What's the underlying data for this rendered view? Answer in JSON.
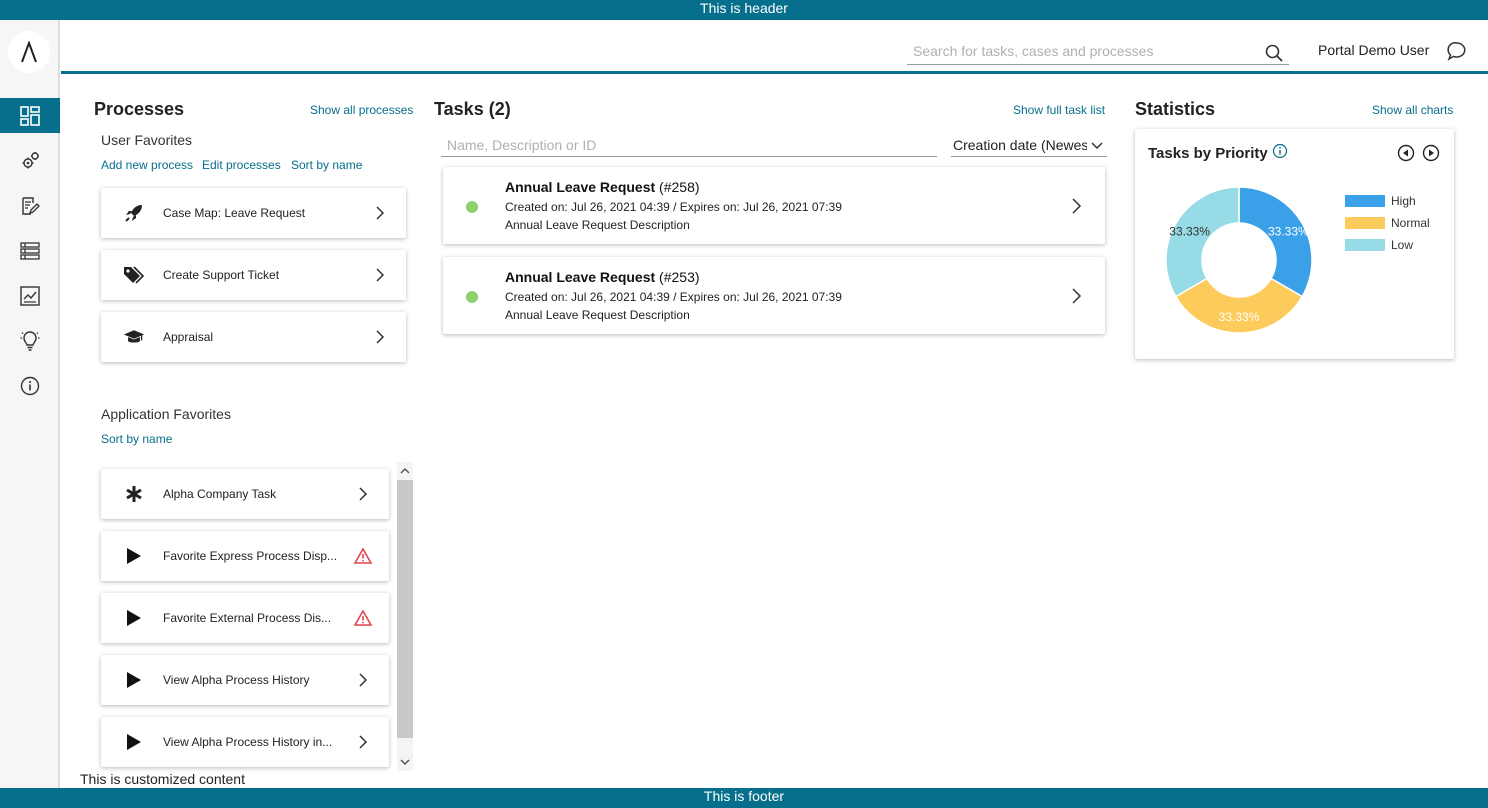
{
  "header_banner": "This is header",
  "footer_banner": "This is footer",
  "custom_content": "This is customized content",
  "topbar": {
    "search_placeholder": "Search for tasks, cases and processes",
    "user_name": "Portal Demo User"
  },
  "processes": {
    "title": "Processes",
    "show_all": "Show all processes",
    "user_favorites_title": "User Favorites",
    "add_new": "Add new process",
    "edit": "Edit processes",
    "sort": "Sort by name",
    "user_items": [
      {
        "label": "Case Map: Leave Request",
        "icon": "rocket-icon"
      },
      {
        "label": "Create Support Ticket",
        "icon": "tag-icon"
      },
      {
        "label": "Appraisal",
        "icon": "graduation-cap-icon"
      }
    ],
    "app_favorites_title": "Application Favorites",
    "app_sort": "Sort by name",
    "app_items": [
      {
        "label": "Alpha Company Task",
        "icon": "asterisk-icon",
        "status": "chevron"
      },
      {
        "label": "Favorite Express Process Disp...",
        "icon": "play-icon",
        "status": "warning"
      },
      {
        "label": "Favorite External Process Dis...",
        "icon": "play-icon",
        "status": "warning"
      },
      {
        "label": "View Alpha Process History",
        "icon": "play-icon",
        "status": "chevron"
      },
      {
        "label": "View Alpha Process History in...",
        "icon": "play-icon",
        "status": "chevron"
      }
    ]
  },
  "tasks": {
    "title": "Tasks (2)",
    "show_full": "Show full task list",
    "filter_placeholder": "Name, Description or ID",
    "sort_value": "Creation date (Newest first)",
    "items": [
      {
        "name": "Annual Leave Request",
        "id": "(#258)",
        "meta": "Created on: Jul 26, 2021 04:39 / Expires on: Jul 26, 2021 07:39",
        "description": "Annual Leave Request Description",
        "status_color": "#8fd16e"
      },
      {
        "name": "Annual Leave Request",
        "id": "(#253)",
        "meta": "Created on: Jul 26, 2021 04:39 / Expires on: Jul 26, 2021 07:39",
        "description": "Annual Leave Request Description",
        "status_color": "#8fd16e"
      }
    ]
  },
  "statistics": {
    "title": "Statistics",
    "show_all": "Show all charts",
    "card_title": "Tasks by Priority"
  },
  "chart_data": {
    "type": "pie",
    "title": "Tasks by Priority",
    "donut": true,
    "categories": [
      "High",
      "Normal",
      "Low"
    ],
    "values": [
      33.33,
      33.33,
      33.33
    ],
    "labels": [
      "33.33%",
      "33.33%",
      "33.33%"
    ],
    "colors": [
      "#3aa0e8",
      "#fdcb5b",
      "#96dbe6"
    ],
    "legend_position": "right"
  },
  "colors": {
    "brand": "#066f8c",
    "link": "#066f8c",
    "status_ok": "#8fd16e",
    "warning": "#e0464e"
  }
}
